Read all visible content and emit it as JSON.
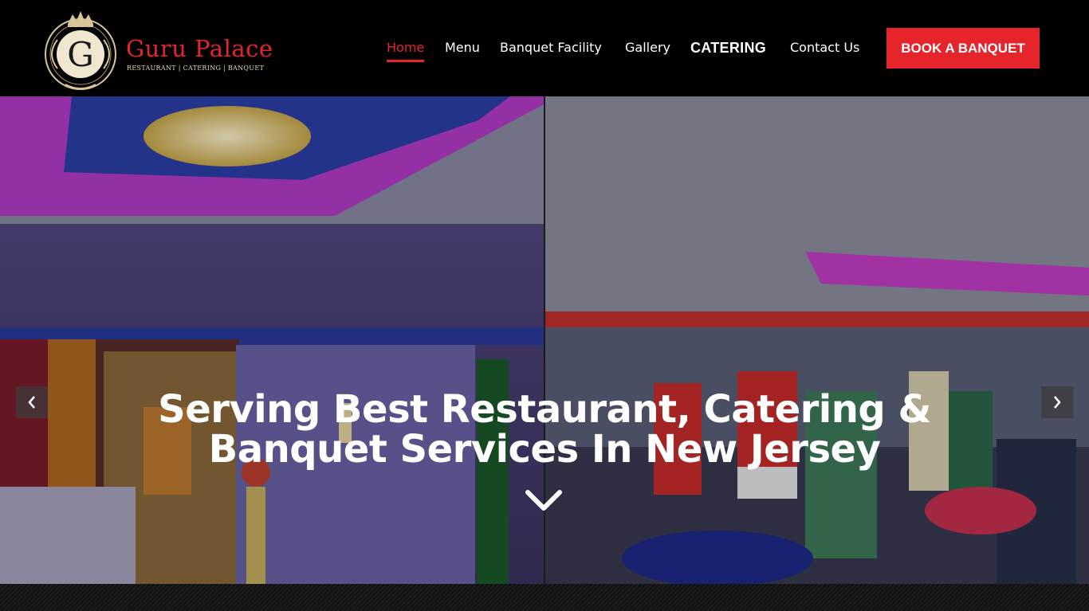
{
  "brand": {
    "name": "Guru Palace",
    "tagline": "RESTAURANT | CATERING | BANQUET",
    "monogram": "G",
    "accent_color": "#e5242b"
  },
  "nav": {
    "items": [
      {
        "label": "Home",
        "active": true
      },
      {
        "label": "Menu"
      },
      {
        "label": "Banquet Facility"
      },
      {
        "label": "Gallery"
      },
      {
        "label": "CATERING"
      },
      {
        "label": "Contact Us"
      }
    ],
    "cta_label": "BOOK A BANQUET"
  },
  "hero": {
    "title_line1": "Serving Best Restaurant, Catering &",
    "title_line2": "Banquet Services In New Jersey",
    "prev_icon": "chevron-left-icon",
    "next_icon": "chevron-right-icon",
    "scroll_icon": "chevron-down-icon"
  }
}
